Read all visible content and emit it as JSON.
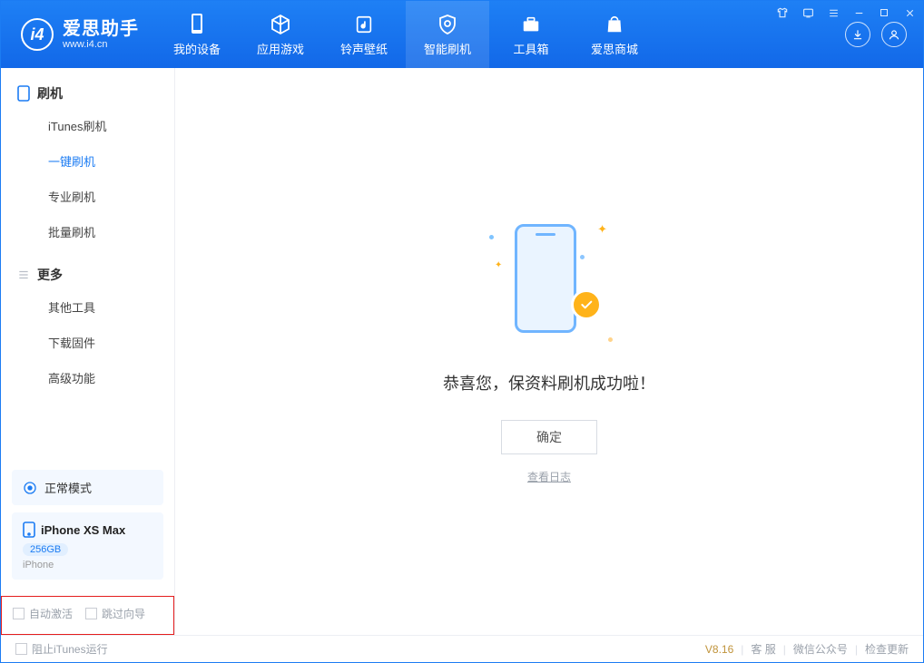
{
  "app": {
    "name": "爱思助手",
    "url": "www.i4.cn"
  },
  "nav": {
    "items": [
      {
        "label": "我的设备"
      },
      {
        "label": "应用游戏"
      },
      {
        "label": "铃声壁纸"
      },
      {
        "label": "智能刷机"
      },
      {
        "label": "工具箱"
      },
      {
        "label": "爱思商城"
      }
    ],
    "active_index": 3
  },
  "sidebar": {
    "group1_label": "刷机",
    "group1_items": [
      {
        "label": "iTunes刷机"
      },
      {
        "label": "一键刷机"
      },
      {
        "label": "专业刷机"
      },
      {
        "label": "批量刷机"
      }
    ],
    "group1_active_index": 1,
    "group2_label": "更多",
    "group2_items": [
      {
        "label": "其他工具"
      },
      {
        "label": "下载固件"
      },
      {
        "label": "高级功能"
      }
    ]
  },
  "device": {
    "mode_label": "正常模式",
    "name": "iPhone XS Max",
    "storage": "256GB",
    "type": "iPhone"
  },
  "options": {
    "auto_activate": "自动激活",
    "skip_guide": "跳过向导"
  },
  "main": {
    "success_message": "恭喜您，保资料刷机成功啦！",
    "confirm": "确定",
    "view_log": "查看日志"
  },
  "status": {
    "block_itunes": "阻止iTunes运行",
    "version": "V8.16",
    "support": "客 服",
    "wechat": "微信公众号",
    "check_update": "检查更新"
  }
}
